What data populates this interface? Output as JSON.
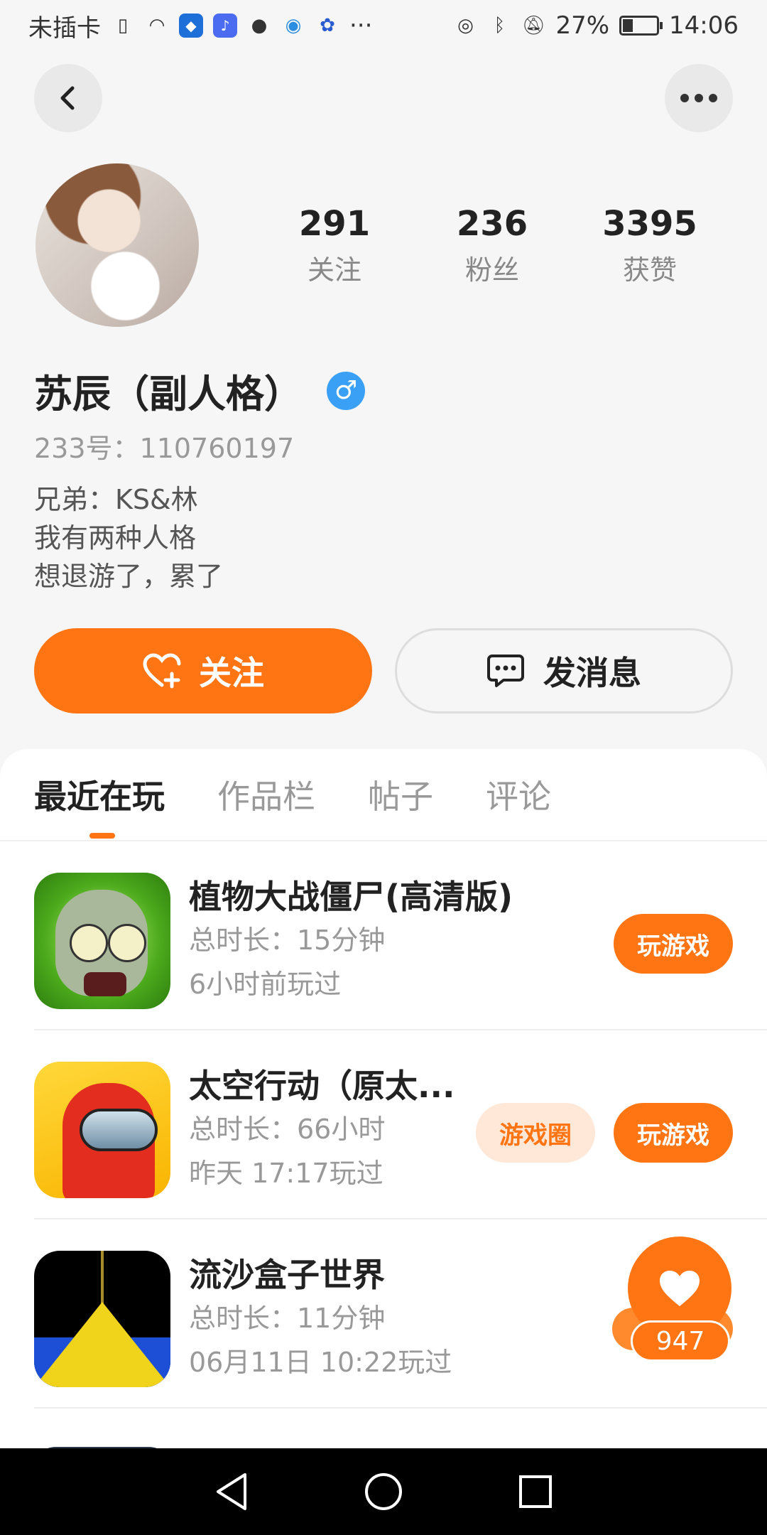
{
  "status_bar": {
    "carrier": "未插卡",
    "battery": "27%",
    "time": "14:06",
    "overflow": "···"
  },
  "profile": {
    "stats": [
      {
        "value": "291",
        "label": "关注"
      },
      {
        "value": "236",
        "label": "粉丝"
      },
      {
        "value": "3395",
        "label": "获赞"
      }
    ],
    "name": "苏辰（副人格）",
    "gender_symbol": "♂",
    "uid": "233号：110760197",
    "bio": [
      "兄弟：KS&林",
      "我有两种人格",
      "想退游了，累了"
    ],
    "follow_label": "关注",
    "message_label": "发消息"
  },
  "tabs": [
    "最近在玩",
    "作品栏",
    "帖子",
    "评论"
  ],
  "games": [
    {
      "name": "植物大战僵尸(高清版)",
      "duration": "总时长：15分钟",
      "last_played": "6小时前玩过",
      "play_label": "玩游戏"
    },
    {
      "name": "太空行动（原太...",
      "duration": "总时长：66小时",
      "last_played": "昨天 17:17玩过",
      "circle_label": "游戏圈",
      "play_label": "玩游戏"
    },
    {
      "name": "流沙盒子世界",
      "duration": "总时长：11分钟",
      "last_played": "06月11日 10:22玩过"
    }
  ],
  "like_count": "947",
  "colors": {
    "accent": "#ff7514",
    "gender": "#3aa0f5"
  }
}
